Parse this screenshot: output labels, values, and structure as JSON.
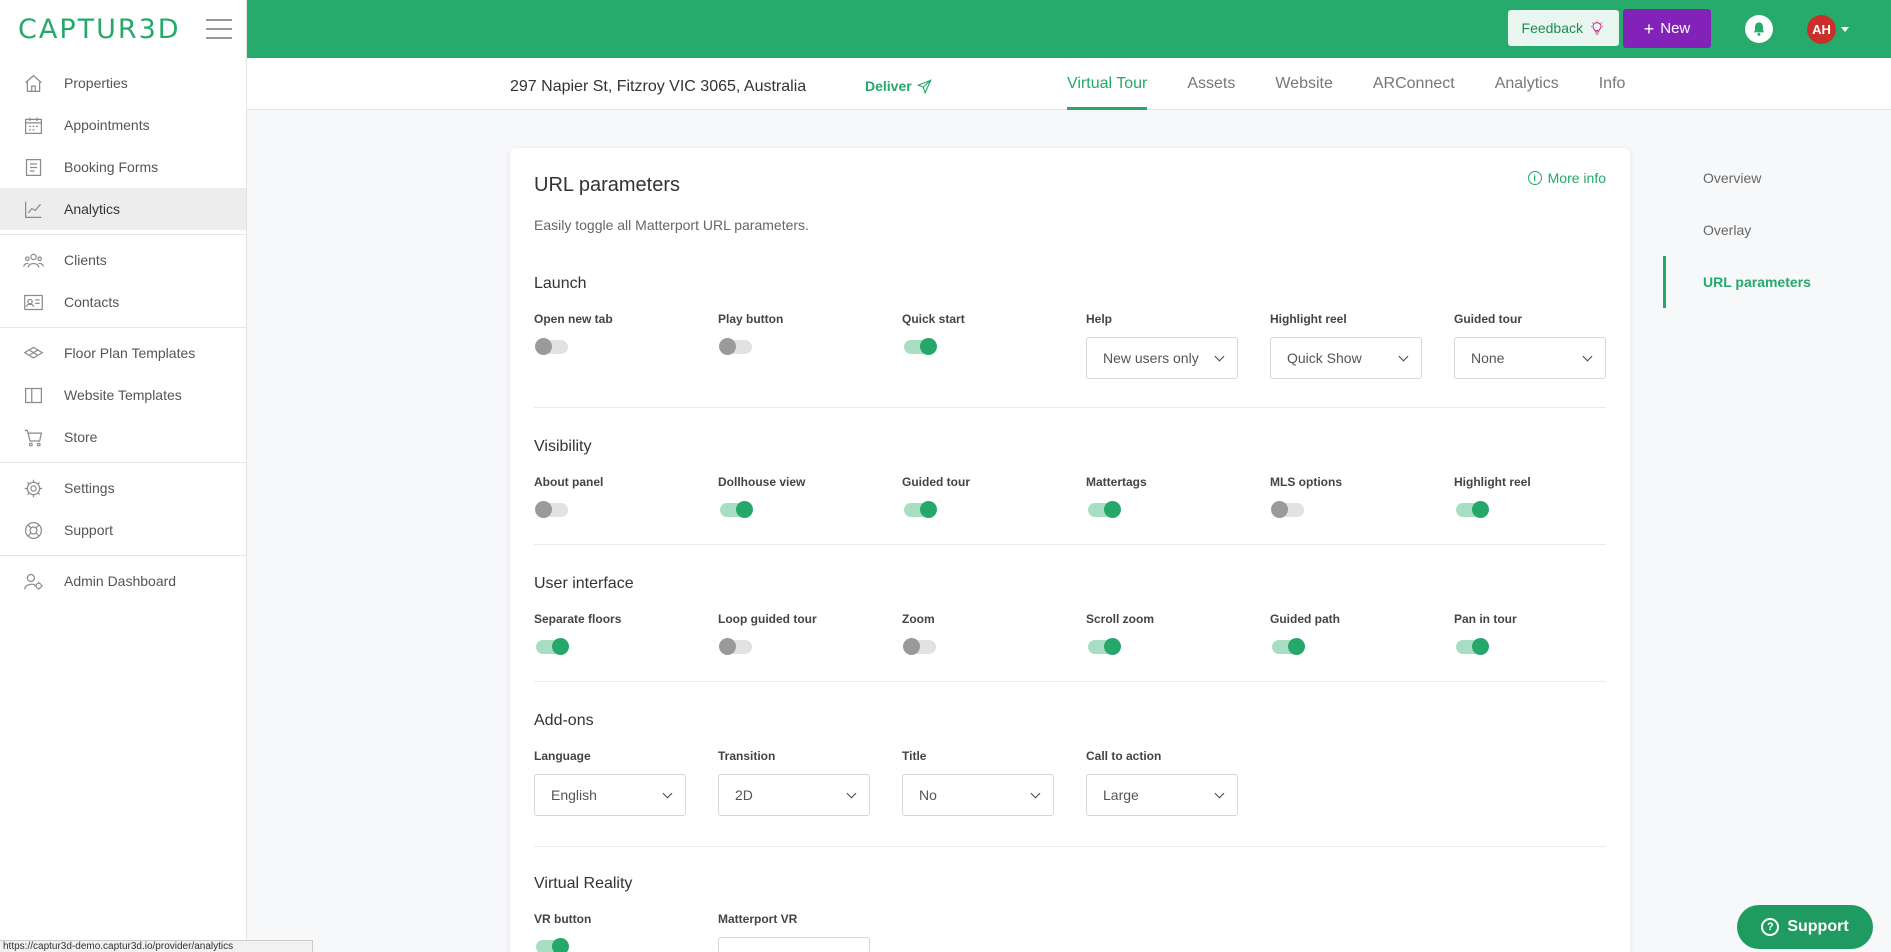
{
  "brand": {
    "logo": "CAPTUR3D"
  },
  "sidebar": {
    "groups": [
      {
        "items": [
          {
            "label": "Properties",
            "icon": "home-icon"
          },
          {
            "label": "Appointments",
            "icon": "calendar-icon"
          },
          {
            "label": "Booking Forms",
            "icon": "form-icon"
          },
          {
            "label": "Analytics",
            "icon": "chart-icon",
            "active": true
          }
        ]
      },
      {
        "items": [
          {
            "label": "Clients",
            "icon": "users-icon"
          },
          {
            "label": "Contacts",
            "icon": "contact-card-icon"
          }
        ]
      },
      {
        "items": [
          {
            "label": "Floor Plan Templates",
            "icon": "layers-icon"
          },
          {
            "label": "Website Templates",
            "icon": "columns-icon"
          },
          {
            "label": "Store",
            "icon": "cart-icon"
          }
        ]
      },
      {
        "items": [
          {
            "label": "Settings",
            "icon": "gear-icon"
          },
          {
            "label": "Support",
            "icon": "lifebuoy-icon"
          }
        ]
      },
      {
        "items": [
          {
            "label": "Admin Dashboard",
            "icon": "user-gear-icon"
          }
        ]
      }
    ]
  },
  "topbar": {
    "feedback_label": "Feedback",
    "new_label": "New",
    "avatar_initials": "AH"
  },
  "property": {
    "address": "297 Napier St, Fitzroy VIC 3065, Australia",
    "deliver_label": "Deliver",
    "tabs": [
      {
        "label": "Virtual Tour",
        "active": true
      },
      {
        "label": "Assets"
      },
      {
        "label": "Website"
      },
      {
        "label": "ARConnect"
      },
      {
        "label": "Analytics"
      },
      {
        "label": "Info"
      }
    ]
  },
  "card": {
    "title": "URL parameters",
    "more_info": "More info",
    "description": "Easily toggle all Matterport URL parameters."
  },
  "sections": {
    "launch": {
      "title": "Launch",
      "toggles": [
        {
          "label": "Open new tab",
          "on": false
        },
        {
          "label": "Play button",
          "on": false
        },
        {
          "label": "Quick start",
          "on": true
        }
      ],
      "selects": [
        {
          "label": "Help",
          "value": "New users only"
        },
        {
          "label": "Highlight reel",
          "value": "Quick Show"
        },
        {
          "label": "Guided tour",
          "value": "None"
        }
      ]
    },
    "visibility": {
      "title": "Visibility",
      "toggles": [
        {
          "label": "About panel",
          "on": false
        },
        {
          "label": "Dollhouse view",
          "on": true
        },
        {
          "label": "Guided tour",
          "on": true
        },
        {
          "label": "Mattertags",
          "on": true
        },
        {
          "label": "MLS options",
          "on": false
        },
        {
          "label": "Highlight reel",
          "on": true
        }
      ]
    },
    "ui": {
      "title": "User interface",
      "toggles": [
        {
          "label": "Separate floors",
          "on": true
        },
        {
          "label": "Loop guided tour",
          "on": false
        },
        {
          "label": "Zoom",
          "on": false
        },
        {
          "label": "Scroll zoom",
          "on": true
        },
        {
          "label": "Guided path",
          "on": true
        },
        {
          "label": "Pan in tour",
          "on": true
        }
      ]
    },
    "addons": {
      "title": "Add-ons",
      "selects": [
        {
          "label": "Language",
          "value": "English"
        },
        {
          "label": "Transition",
          "value": "2D"
        },
        {
          "label": "Title",
          "value": "No"
        },
        {
          "label": "Call to action",
          "value": "Large"
        }
      ]
    },
    "vr": {
      "title": "Virtual Reality",
      "toggles": [
        {
          "label": "VR button",
          "on": true
        }
      ],
      "selects": [
        {
          "label": "Matterport VR",
          "value": ""
        }
      ]
    }
  },
  "side_nav": [
    {
      "label": "Overview"
    },
    {
      "label": "Overlay"
    },
    {
      "label": "URL parameters",
      "active": true
    }
  ],
  "support_label": "Support",
  "status_url": "https://captur3d-demo.captur3d.io/provider/analytics",
  "colors": {
    "brand_green": "#27ab6c",
    "new_purple": "#8222b8",
    "avatar_red": "#c9302c"
  }
}
